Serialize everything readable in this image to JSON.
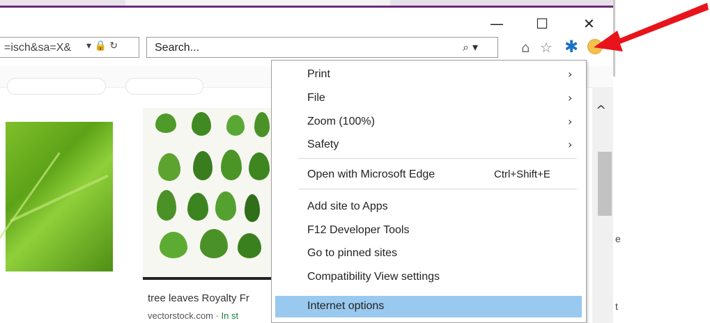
{
  "window": {
    "minimize_glyph": "—",
    "maximize_glyph": "☐",
    "close_glyph": "✕"
  },
  "address_bar": {
    "url_fragment": "=isch&sa=X&",
    "controls": "▾ 🔒 ↻"
  },
  "search_box": {
    "placeholder": "Search...",
    "icon_glyph": "⌕ ▾"
  },
  "toolbar": {
    "home_icon": "⌂",
    "favorites_icon": "☆",
    "tools_icon": "✱"
  },
  "results": {
    "caption": "tree leaves Royalty Fr",
    "source": "vectorstock.com",
    "source_sep": " · ",
    "stock": "In st"
  },
  "scrollbar": {
    "up_glyph": "^"
  },
  "edge_chars": {
    "e1": "e",
    "e2": "t"
  },
  "tools_menu": {
    "items": [
      {
        "label": "Print",
        "chevron": "›"
      },
      {
        "label": "File",
        "chevron": "›"
      },
      {
        "label": "Zoom (100%)",
        "chevron": "›"
      },
      {
        "label": "Safety",
        "chevron": "›"
      },
      {
        "label": "Open with Microsoft Edge",
        "shortcut": "Ctrl+Shift+E"
      },
      {
        "label": "Add site to Apps"
      },
      {
        "label": "F12 Developer Tools"
      },
      {
        "label": "Go to pinned sites"
      },
      {
        "label": "Compatibility View settings"
      },
      {
        "label": "Internet options",
        "highlighted": true
      }
    ]
  },
  "colors": {
    "menu_highlight": "#99c9ef",
    "gear": "#1c72c4",
    "arrow": "#e8141b",
    "title_accent": "#6b2d7a"
  }
}
